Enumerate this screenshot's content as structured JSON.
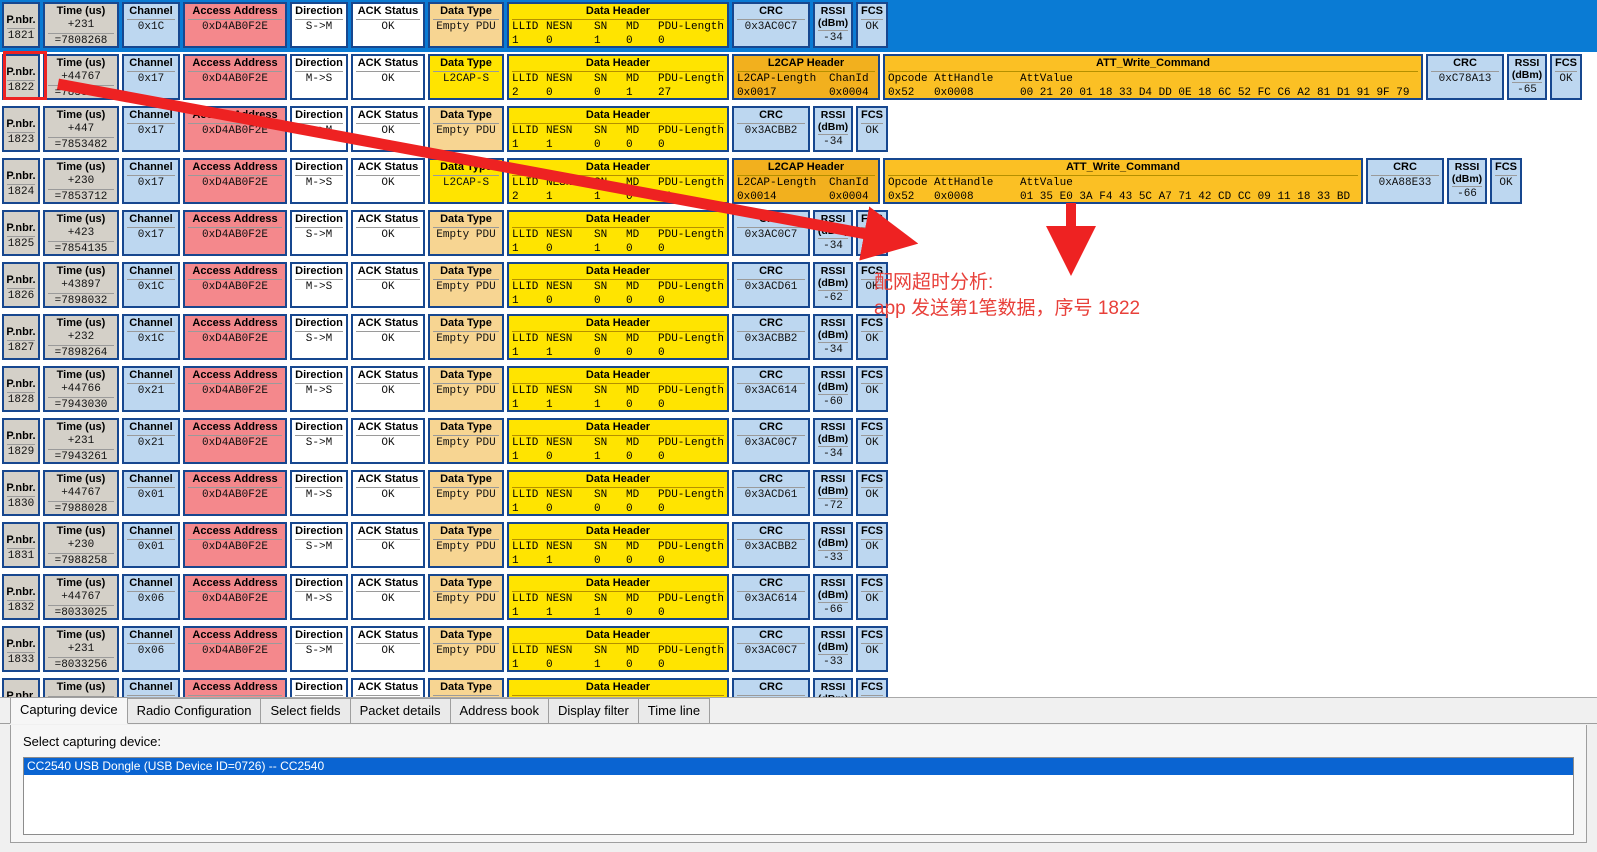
{
  "columns": {
    "pnbr": "P.nbr.",
    "time": "Time (us)",
    "channel": "Channel",
    "access_address": "Access Address",
    "direction": "Direction",
    "ack_status": "ACK Status",
    "data_type": "Data Type",
    "data_header": "Data Header",
    "l2cap_header": "L2CAP Header",
    "att_write_command": "ATT_Write_Command",
    "crc": "CRC",
    "rssi": "RSSI (dBm)",
    "rssi_line1": "RSSI",
    "rssi_line2": "(dBm)",
    "fcs": "FCS",
    "dh_llid": "LLID",
    "dh_nesn": "NESN",
    "dh_sn": "SN",
    "dh_md": "MD",
    "dh_pdu_length": "PDU-Length",
    "l2cap_length": "L2CAP-Length",
    "l2cap_chanid": "ChanId",
    "att_opcode": "Opcode",
    "att_handle": "AttHandle",
    "att_value": "AttValue"
  },
  "packets": [
    {
      "pnbr": "1821",
      "time_delta": "+231",
      "time_abs": "=7808268",
      "channel": "0x1C",
      "access_address": "0xD4AB0F2E",
      "direction": "S->M",
      "ack": "OK",
      "data_type": "Empty PDU",
      "llid": "1",
      "nesn": "0",
      "sn": "1",
      "md": "0",
      "pdu_length": "0",
      "crc": "0x3AC0C7",
      "rssi": "-34",
      "fcs": "OK",
      "selected": true,
      "has_l2cap": false
    },
    {
      "pnbr": "1822",
      "time_delta": "+44767",
      "time_abs": "=7853035",
      "channel": "0x17",
      "access_address": "0xD4AB0F2E",
      "direction": "M->S",
      "ack": "OK",
      "data_type": "L2CAP-S",
      "llid": "2",
      "nesn": "0",
      "sn": "0",
      "md": "1",
      "pdu_length": "27",
      "l2cap_length": "0x0017",
      "chanid": "0x0004",
      "opcode": "0x52",
      "att_handle": "0x0008",
      "att_value": "00 21 20 01 18 33 D4 DD 0E 18 6C 52 FC C6 A2 81 D1 91 9F 79",
      "crc": "0xC78A13",
      "rssi": "-65",
      "fcs": "OK",
      "selected": false,
      "has_l2cap": true
    },
    {
      "pnbr": "1823",
      "time_delta": "+447",
      "time_abs": "=7853482",
      "channel": "0x17",
      "access_address": "0xD4AB0F2E",
      "direction": "S->M",
      "ack": "OK",
      "data_type": "Empty PDU",
      "llid": "1",
      "nesn": "1",
      "sn": "0",
      "md": "0",
      "pdu_length": "0",
      "crc": "0x3ACBB2",
      "rssi": "-34",
      "fcs": "OK",
      "selected": false,
      "has_l2cap": false
    },
    {
      "pnbr": "1824",
      "time_delta": "+230",
      "time_abs": "=7853712",
      "channel": "0x17",
      "access_address": "0xD4AB0F2E",
      "direction": "M->S",
      "ack": "OK",
      "data_type": "L2CAP-S",
      "llid": "2",
      "nesn": "1",
      "sn": "1",
      "md": "0",
      "pdu_length": "24",
      "l2cap_length": "0x0014",
      "chanid": "0x0004",
      "opcode": "0x52",
      "att_handle": "0x0008",
      "att_value": "01 35 E0 3A F4 43 5C A7 71 42 CD CC 09 11 18 33 BD",
      "crc": "0xA88E33",
      "rssi": "-66",
      "fcs": "OK",
      "selected": false,
      "has_l2cap": true
    },
    {
      "pnbr": "1825",
      "time_delta": "+423",
      "time_abs": "=7854135",
      "channel": "0x17",
      "access_address": "0xD4AB0F2E",
      "direction": "S->M",
      "ack": "OK",
      "data_type": "Empty PDU",
      "llid": "1",
      "nesn": "0",
      "sn": "1",
      "md": "0",
      "pdu_length": "0",
      "crc": "0x3AC0C7",
      "rssi": "-34",
      "fcs": "OK",
      "selected": false,
      "has_l2cap": false
    },
    {
      "pnbr": "1826",
      "time_delta": "+43897",
      "time_abs": "=7898032",
      "channel": "0x1C",
      "access_address": "0xD4AB0F2E",
      "direction": "M->S",
      "ack": "OK",
      "data_type": "Empty PDU",
      "llid": "1",
      "nesn": "0",
      "sn": "0",
      "md": "0",
      "pdu_length": "0",
      "crc": "0x3ACD61",
      "rssi": "-62",
      "fcs": "OK",
      "selected": false,
      "has_l2cap": false
    },
    {
      "pnbr": "1827",
      "time_delta": "+232",
      "time_abs": "=7898264",
      "channel": "0x1C",
      "access_address": "0xD4AB0F2E",
      "direction": "S->M",
      "ack": "OK",
      "data_type": "Empty PDU",
      "llid": "1",
      "nesn": "1",
      "sn": "0",
      "md": "0",
      "pdu_length": "0",
      "crc": "0x3ACBB2",
      "rssi": "-34",
      "fcs": "OK",
      "selected": false,
      "has_l2cap": false
    },
    {
      "pnbr": "1828",
      "time_delta": "+44766",
      "time_abs": "=7943030",
      "channel": "0x21",
      "access_address": "0xD4AB0F2E",
      "direction": "M->S",
      "ack": "OK",
      "data_type": "Empty PDU",
      "llid": "1",
      "nesn": "1",
      "sn": "1",
      "md": "0",
      "pdu_length": "0",
      "crc": "0x3AC614",
      "rssi": "-60",
      "fcs": "OK",
      "selected": false,
      "has_l2cap": false
    },
    {
      "pnbr": "1829",
      "time_delta": "+231",
      "time_abs": "=7943261",
      "channel": "0x21",
      "access_address": "0xD4AB0F2E",
      "direction": "S->M",
      "ack": "OK",
      "data_type": "Empty PDU",
      "llid": "1",
      "nesn": "0",
      "sn": "1",
      "md": "0",
      "pdu_length": "0",
      "crc": "0x3AC0C7",
      "rssi": "-34",
      "fcs": "OK",
      "selected": false,
      "has_l2cap": false
    },
    {
      "pnbr": "1830",
      "time_delta": "+44767",
      "time_abs": "=7988028",
      "channel": "0x01",
      "access_address": "0xD4AB0F2E",
      "direction": "M->S",
      "ack": "OK",
      "data_type": "Empty PDU",
      "llid": "1",
      "nesn": "0",
      "sn": "0",
      "md": "0",
      "pdu_length": "0",
      "crc": "0x3ACD61",
      "rssi": "-72",
      "fcs": "OK",
      "selected": false,
      "has_l2cap": false
    },
    {
      "pnbr": "1831",
      "time_delta": "+230",
      "time_abs": "=7988258",
      "channel": "0x01",
      "access_address": "0xD4AB0F2E",
      "direction": "S->M",
      "ack": "OK",
      "data_type": "Empty PDU",
      "llid": "1",
      "nesn": "1",
      "sn": "0",
      "md": "0",
      "pdu_length": "0",
      "crc": "0x3ACBB2",
      "rssi": "-33",
      "fcs": "OK",
      "selected": false,
      "has_l2cap": false
    },
    {
      "pnbr": "1832",
      "time_delta": "+44767",
      "time_abs": "=8033025",
      "channel": "0x06",
      "access_address": "0xD4AB0F2E",
      "direction": "M->S",
      "ack": "OK",
      "data_type": "Empty PDU",
      "llid": "1",
      "nesn": "1",
      "sn": "1",
      "md": "0",
      "pdu_length": "0",
      "crc": "0x3AC614",
      "rssi": "-66",
      "fcs": "OK",
      "selected": false,
      "has_l2cap": false
    },
    {
      "pnbr": "1833",
      "time_delta": "+231",
      "time_abs": "=8033256",
      "channel": "0x06",
      "access_address": "0xD4AB0F2E",
      "direction": "S->M",
      "ack": "OK",
      "data_type": "Empty PDU",
      "llid": "1",
      "nesn": "0",
      "sn": "1",
      "md": "0",
      "pdu_length": "0",
      "crc": "0x3AC0C7",
      "rssi": "-33",
      "fcs": "OK",
      "selected": false,
      "has_l2cap": false
    },
    {
      "pnbr": "",
      "time_delta": "",
      "time_abs": "",
      "channel": "",
      "access_address": "",
      "direction": "",
      "ack": "",
      "data_type": "",
      "llid": "",
      "nesn": "",
      "sn": "",
      "md": "",
      "pdu_length": "",
      "crc": "",
      "rssi": "",
      "fcs": "",
      "selected": false,
      "has_l2cap": false,
      "clipped": true
    }
  ],
  "annotation": {
    "line1": "配网超时分析:",
    "line2": "app 发送第1笔数据，序号 1822",
    "color": "#e8403a"
  },
  "bottom": {
    "tabs": [
      {
        "label": "Capturing device",
        "active": true
      },
      {
        "label": "Radio Configuration",
        "active": false
      },
      {
        "label": "Select fields",
        "active": false
      },
      {
        "label": "Packet details",
        "active": false
      },
      {
        "label": "Address book",
        "active": false
      },
      {
        "label": "Display filter",
        "active": false
      },
      {
        "label": "Time line",
        "active": false
      }
    ],
    "select_label": "Select capturing device:",
    "devices": [
      {
        "label": "CC2540 USB Dongle (USB Device ID=0726) -- CC2540",
        "selected": true
      }
    ]
  }
}
